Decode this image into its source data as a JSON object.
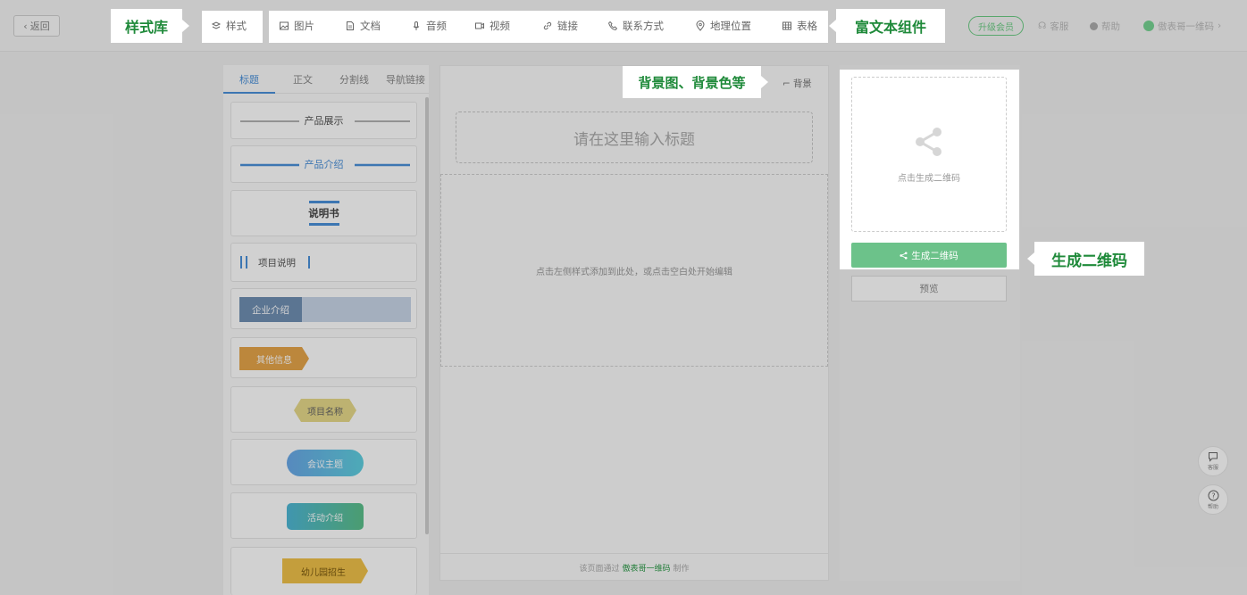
{
  "topbar": {
    "back_label": "返回",
    "style_label": "样式",
    "rich_items": [
      "图片",
      "文档",
      "音频",
      "视频",
      "链接",
      "联系方式",
      "地理位置",
      "表格"
    ],
    "upgrade_label": "升级会员",
    "service_label": "客服",
    "help_label": "帮助",
    "user_label": "傲表哥一维码"
  },
  "annotations": {
    "style_library": "样式库",
    "rich_text": "富文本组件",
    "background": "背景图、背景色等",
    "generate_qr": "生成二维码"
  },
  "left_panel": {
    "tabs": [
      "标题",
      "正文",
      "分割线",
      "导航链接"
    ],
    "active_tab": "标题",
    "styles": [
      "产品展示",
      "产品介绍",
      "说明书",
      "项目说明",
      "企业介绍",
      "其他信息",
      "项目名称",
      "会议主题",
      "活动介绍",
      "幼儿园招生"
    ]
  },
  "editor": {
    "background_link": "背景",
    "title_placeholder": "请在这里输入标题",
    "drop_hint": "点击左侧样式添加到此处，或点击空白处开始编辑",
    "footer_prefix": "该页面通过",
    "footer_link": "傲表哥一维码",
    "footer_suffix": "制作"
  },
  "right_panel": {
    "qr_hint": "点击生成二维码",
    "generate_button": "生成二维码",
    "preview_button": "预览"
  },
  "floating": {
    "service": "客服",
    "help": "帮助"
  },
  "colors": {
    "accent_green": "#1f8a3a",
    "button_green": "#6cc28a",
    "link_blue": "#4a90d9",
    "banner_blue": "#6f8fb3",
    "tag_orange": "#e6a54a",
    "tag_yellow": "#e7d98a",
    "grad_blue": "#5fc6e8",
    "grad_green": "#5cc08a",
    "tag_gold": "#f0c14a"
  }
}
